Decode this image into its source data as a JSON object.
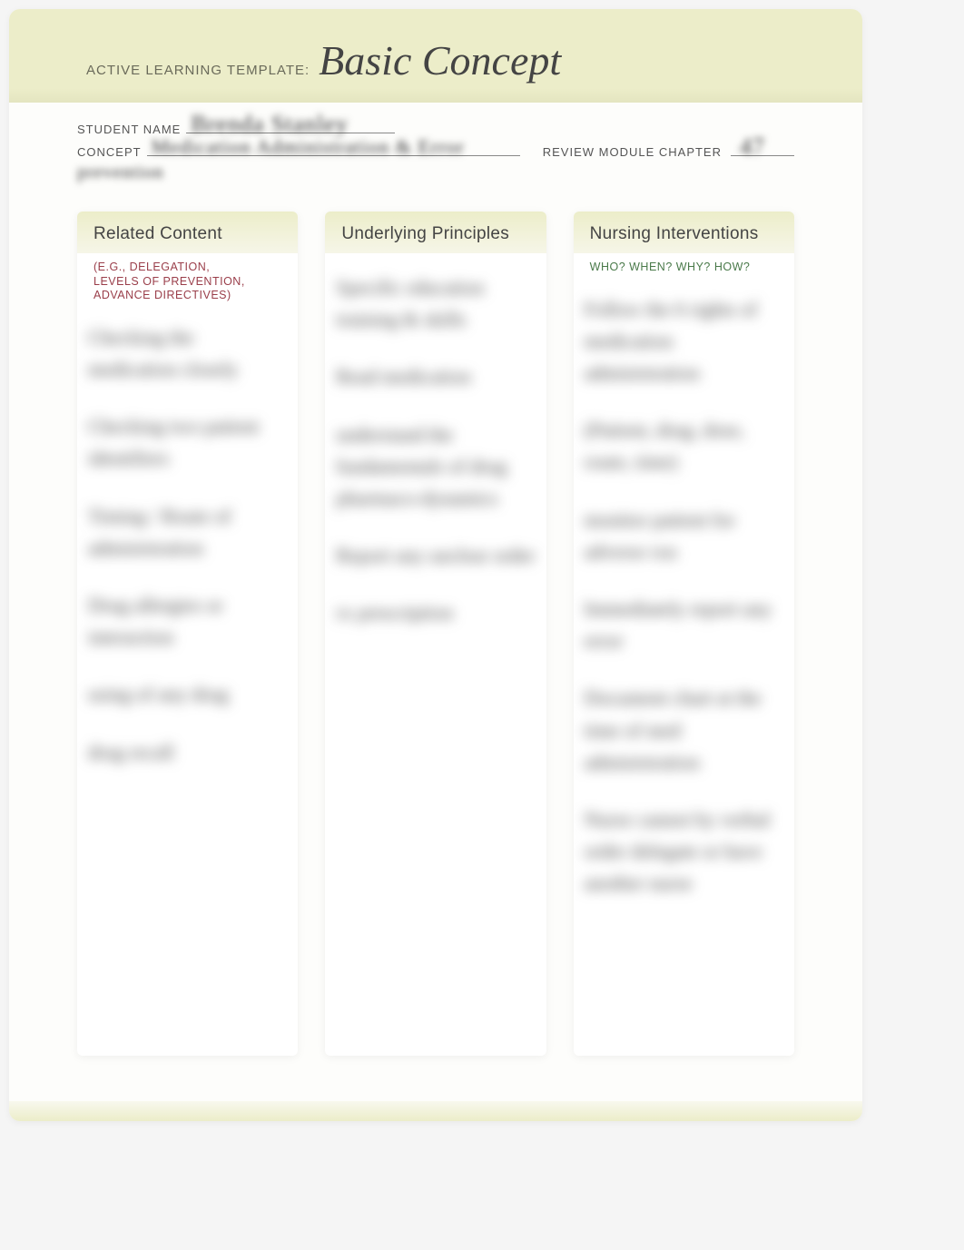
{
  "header": {
    "prefix": "ACTIVE LEARNING TEMPLATE:",
    "title": "Basic Concept"
  },
  "form": {
    "student_label": "STUDENT NAME",
    "concept_label": "CONCEPT",
    "review_label": "REVIEW MODULE CHAPTER"
  },
  "cards": {
    "related": {
      "title": "Related Content",
      "subtitle": "(E.G., DELEGATION,\nLEVELS OF PREVENTION,\nADVANCE DIRECTIVES)"
    },
    "principles": {
      "title": "Underlying Principles"
    },
    "nursing": {
      "title": "Nursing Interventions",
      "subtitle": "WHO? WHEN? WHY? HOW?"
    }
  }
}
